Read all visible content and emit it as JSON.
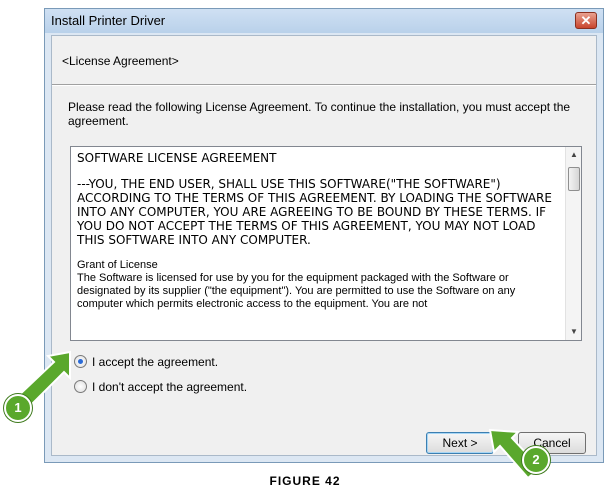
{
  "window": {
    "title": "Install Printer Driver",
    "close_glyph": "✕"
  },
  "section_title": "<License Agreement>",
  "instruction": "Please read the following License Agreement. To continue the installation, you must accept the agreement.",
  "license": {
    "heading": "SOFTWARE LICENSE AGREEMENT",
    "para1": "---YOU, THE END USER, SHALL USE THIS SOFTWARE(\"THE SOFTWARE\") ACCORDING TO THE TERMS OF THIS AGREEMENT. BY LOADING THE SOFTWARE INTO ANY COMPUTER, YOU ARE AGREEING TO BE BOUND BY THESE TERMS. IF YOU DO NOT ACCEPT THE TERMS OF THIS AGREEMENT, YOU MAY NOT LOAD THIS SOFTWARE INTO ANY COMPUTER.",
    "grant_heading": "Grant of License",
    "grant_text": "The Software is licensed for use by you for the equipment packaged with the Software or designated by its supplier (\"the equipment\"). You are permitted to use the Software on any computer which permits electronic access to the equipment. You are not"
  },
  "options": {
    "accept_label": "I accept the agreement.",
    "decline_label": "I don't accept the agreement.",
    "selected": "accept"
  },
  "buttons": {
    "next_label": "Next >",
    "cancel_label": "Cancel"
  },
  "callouts": {
    "badge1": "1",
    "badge2": "2",
    "color": "#5aa82c"
  },
  "caption": "FIGURE 42"
}
